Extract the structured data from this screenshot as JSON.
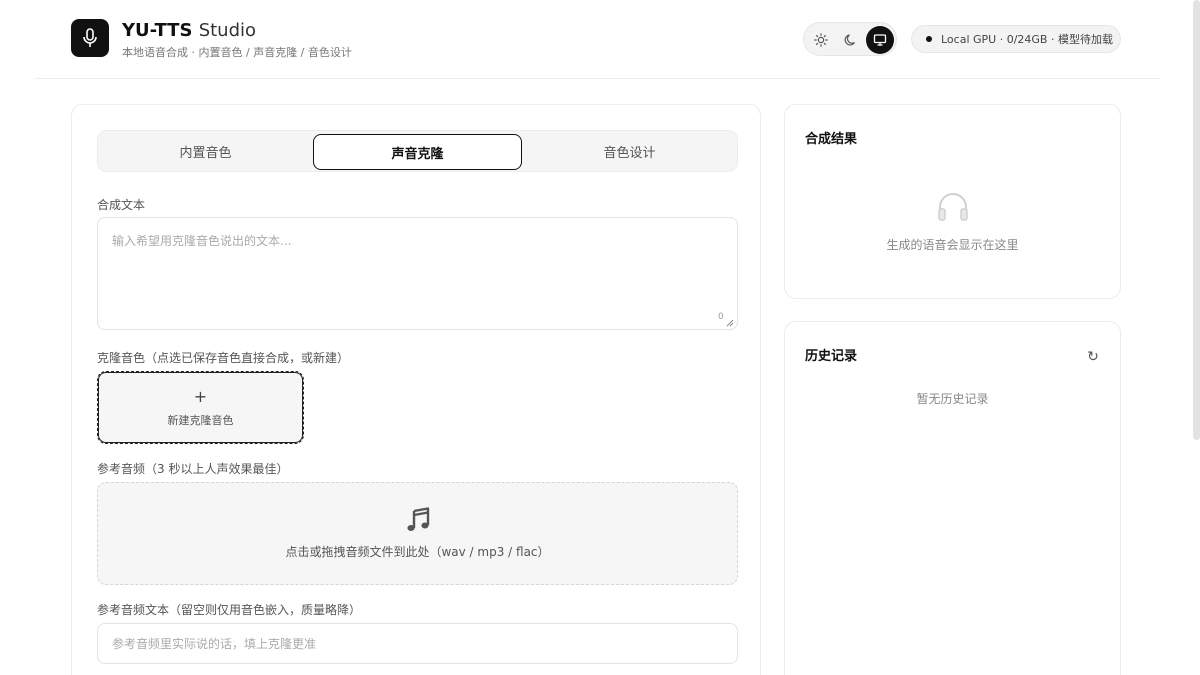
{
  "header": {
    "title_main": "YU-TTS",
    "title_light": "Studio",
    "subtitle": "本地语音合成 · 内置音色 / 声音克隆 / 音色设计",
    "logo_icon": "microphone-icon",
    "theme_options": [
      "sun-icon",
      "moon-icon",
      "monitor-icon"
    ],
    "theme_selected": "monitor-icon",
    "status": "Local GPU · 0/24GB · 模型待加载"
  },
  "tabs": [
    {
      "label": "内置音色",
      "active": false
    },
    {
      "label": "声音克隆",
      "active": true
    },
    {
      "label": "音色设计",
      "active": false
    }
  ],
  "form": {
    "text_label": "合成文本",
    "text_placeholder": "输入希望用克隆音色说出的文本...",
    "text_value": "",
    "char_count": "0",
    "clone_label": "克隆音色（点选已保存音色直接合成，或新建）",
    "new_voice_plus": "+",
    "new_voice_label": "新建克隆音色",
    "ref_audio_label": "参考音频（3 秒以上人声效果最佳）",
    "dropzone_icon": "music-note-icon",
    "dropzone_hint": "点击或拖拽音频文件到此处（wav / mp3 / flac）",
    "ref_text_label": "参考音频文本（留空则仅用音色嵌入，质量略降）",
    "ref_text_placeholder": "参考音频里实际说的话，填上克隆更准",
    "ref_text_value": ""
  },
  "result": {
    "title": "合成结果",
    "icon": "headphones-icon",
    "empty": "生成的语音会显示在这里"
  },
  "history": {
    "title": "历史记录",
    "refresh_icon": "refresh-icon",
    "refresh_glyph": "↻",
    "empty": "暂无历史记录"
  },
  "colors": {
    "accent": "#111111",
    "background": "#ffffff",
    "muted_text": "#888888",
    "border": "#ececec"
  }
}
